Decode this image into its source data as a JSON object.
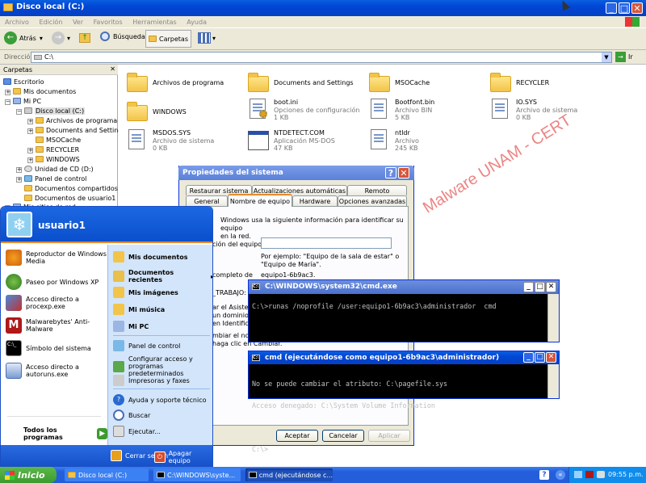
{
  "explorer": {
    "title": "Disco local (C:)",
    "menu": [
      "Archivo",
      "Edición",
      "Ver",
      "Favoritos",
      "Herramientas",
      "Ayuda"
    ],
    "toolbar": {
      "back": "Atrás",
      "search": "Búsqueda",
      "folders": "Carpetas"
    },
    "address_label": "Dirección",
    "address": "C:\\",
    "go": "Ir",
    "folders_pane_title": "Carpetas",
    "tree": [
      "Escritorio",
      "Mis documentos",
      "Mi PC",
      "Disco local (C:)",
      "Archivos de programa",
      "Documents and Settings",
      "MSOCache",
      "RECYCLER",
      "WINDOWS",
      "Unidad de CD (D:)",
      "Panel de control",
      "Documentos compartidos",
      "Documentos de usuario1",
      "Mis sitios de red"
    ],
    "items": [
      {
        "name": "Archivos de programa",
        "line2": "",
        "line3": ""
      },
      {
        "name": "Documents and Settings",
        "line2": "",
        "line3": ""
      },
      {
        "name": "MSOCache",
        "line2": "",
        "line3": ""
      },
      {
        "name": "RECYCLER",
        "line2": "",
        "line3": ""
      },
      {
        "name": "WINDOWS",
        "line2": "",
        "line3": ""
      },
      {
        "name": "boot.ini",
        "line2": "Opciones de configuración",
        "line3": "1 KB"
      },
      {
        "name": "Bootfont.bin",
        "line2": "Archivo BIN",
        "line3": "5 KB"
      },
      {
        "name": "IO.SYS",
        "line2": "Archivo de sistema",
        "line3": "0 KB"
      },
      {
        "name": "MSDOS.SYS",
        "line2": "Archivo de sistema",
        "line3": "0 KB"
      },
      {
        "name": "NTDETECT.COM",
        "line2": "Aplicación MS-DOS",
        "line3": "47 KB"
      },
      {
        "name": "ntldr",
        "line2": "Archivo",
        "line3": "245 KB"
      }
    ]
  },
  "sysprops": {
    "title": "Propiedades del sistema",
    "tabs_back": [
      "Restaurar sistema",
      "Actualizaciones automáticas",
      "Remoto"
    ],
    "tabs_front": [
      "General",
      "Nombre de equipo",
      "Hardware",
      "Opciones avanzadas"
    ],
    "desc1": "Windows usa la siguiente información para identificar su equipo",
    "desc2": "en la red.",
    "desc_label": "ción del equipo:",
    "example1": "Por ejemplo: \"Equipo de la sala de estar\" o",
    "example2": "\"Equipo de María\".",
    "fullname_label": "completo de",
    "fullname": "equipo1-6b9ac3.",
    "workgroup_label": "_TRABAJO:",
    "assist1": "ar el Asistente",
    "assist2": "un dominio y",
    "assist3": "en Identificac",
    "change1": "mbiar el nomb",
    "change2": "haga clic en Cambiar.",
    "ok": "Aceptar",
    "cancel": "Cancelar",
    "apply": "Aplicar"
  },
  "cmd1": {
    "title": "C:\\WINDOWS\\system32\\cmd.exe",
    "line": "C:\\>runas /noprofile /user:equipo1-6b9ac3\\administrador  cmd"
  },
  "cmd2": {
    "title": "cmd (ejecutándose como equipo1-6b9ac3\\administrador)",
    "lines": [
      "No se puede cambiar el atributo: C:\\pagefile.sys",
      "Acceso denegado: C:\\System Volume Information",
      "",
      "C:\\>"
    ]
  },
  "watermark": "Malware UNAM - CERT",
  "startmenu": {
    "user": "usuario1",
    "left": [
      [
        "Reproductor de Windows",
        "Media"
      ],
      [
        "Paseo por Windows XP",
        ""
      ],
      [
        "Acceso directo a",
        "procexp.exe"
      ],
      [
        "Malwarebytes' Anti-Malware",
        ""
      ],
      [
        "Símbolo del sistema",
        ""
      ],
      [
        "Acceso directo a",
        "autoruns.exe"
      ]
    ],
    "all_programs": "Todos los programas",
    "right": [
      "Mis documentos",
      "Documentos recientes",
      "Mis imágenes",
      "Mi música",
      "Mi PC",
      "Panel de control",
      "Configurar acceso y",
      "programas predeterminados",
      "Impresoras y faxes",
      "Ayuda y soporte técnico",
      "Buscar",
      "Ejecutar..."
    ],
    "logoff": "Cerrar sesión",
    "shutdown": "Apagar equipo"
  },
  "taskbar": {
    "start": "Inicio",
    "tasks": [
      "Disco local (C:)",
      "C:\\WINDOWS\\syste...",
      "cmd (ejecutándose c..."
    ],
    "clock": "09:55 p.m."
  },
  "colors": {
    "xp_blue": "#0a5fe0",
    "taskbar": "#245edb",
    "start_green": "#3c9a2e",
    "watermark": "#e85a5a"
  }
}
